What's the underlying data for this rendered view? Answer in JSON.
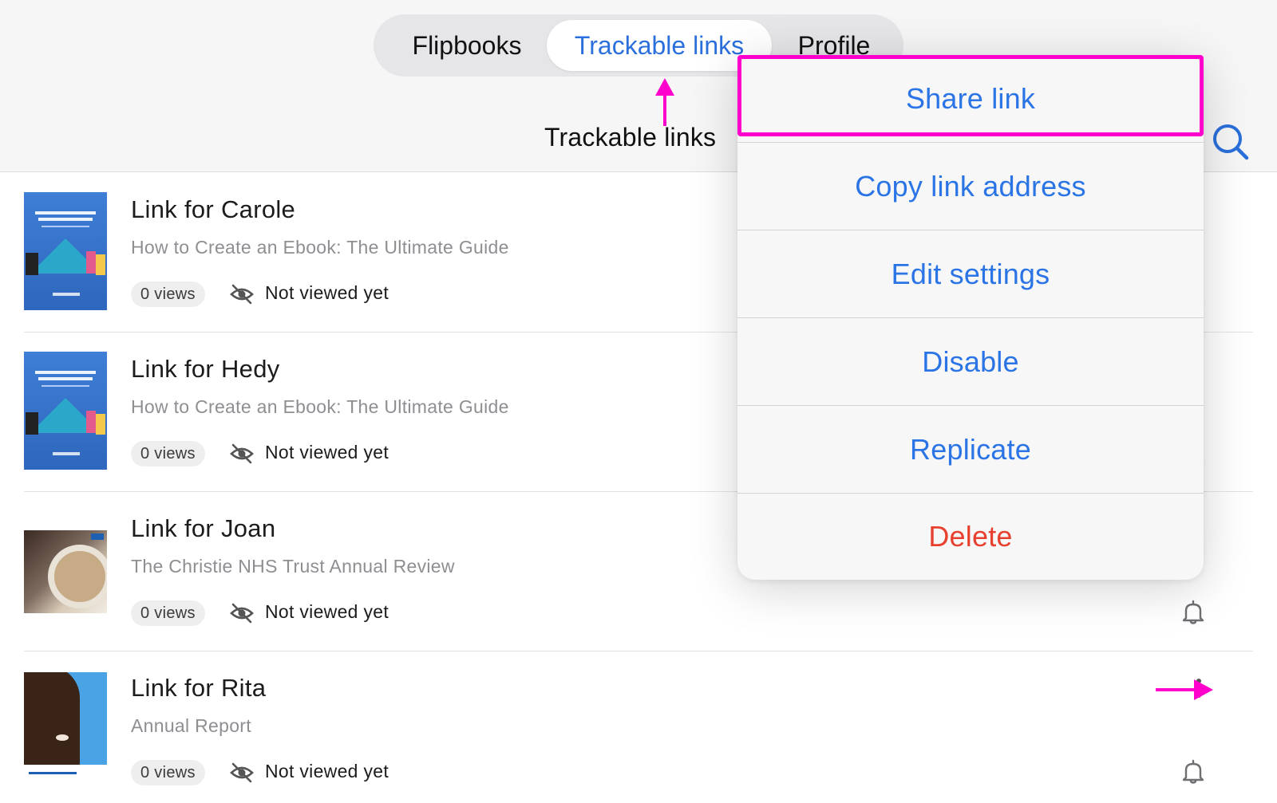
{
  "tabs": [
    {
      "label": "Flipbooks"
    },
    {
      "label": "Trackable links"
    },
    {
      "label": "Profile"
    }
  ],
  "header": {
    "title": "Trackable links",
    "search_icon": "search-icon"
  },
  "links": [
    {
      "title": "Link for Carole",
      "subtitle": "How to Create an Ebook: The Ultimate Guide",
      "views": "0 views",
      "status": "Not viewed yet"
    },
    {
      "title": "Link for Hedy",
      "subtitle": "How to Create an Ebook: The Ultimate Guide",
      "views": "0 views",
      "status": "Not viewed yet"
    },
    {
      "title": "Link for Joan",
      "subtitle": "The Christie NHS Trust Annual Review",
      "views": "0 views",
      "status": "Not viewed yet"
    },
    {
      "title": "Link for Rita",
      "subtitle": "Annual Report",
      "views": "0 views",
      "status": "Not viewed yet"
    }
  ],
  "menu": {
    "items": [
      {
        "label": "Share link"
      },
      {
        "label": "Copy link address"
      },
      {
        "label": "Edit settings"
      },
      {
        "label": "Disable"
      },
      {
        "label": "Replicate"
      },
      {
        "label": "Delete"
      }
    ]
  },
  "colors": {
    "accent": "#2a74e6",
    "destructive": "#e8402f",
    "annotation": "#ff00cc"
  }
}
